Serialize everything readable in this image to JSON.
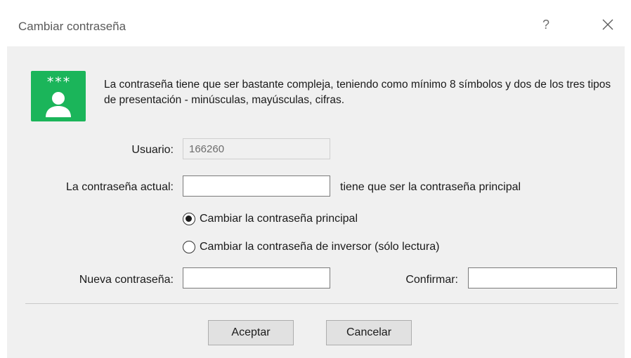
{
  "window": {
    "title": "Cambiar contraseña",
    "help_glyph": "?",
    "close_icon": "close-icon"
  },
  "info": {
    "icon": "user-password-icon",
    "icon_color": "#1bb55a",
    "icon_stars": "***",
    "text": "La contraseña tiene que ser bastante compleja, teniendo como mínimo 8 símbolos y dos de los tres tipos de presentación - minúsculas, mayúsculas, cifras."
  },
  "form": {
    "user_label": "Usuario:",
    "user_value": "166260",
    "current_password_label": "La contraseña actual:",
    "current_password_value": "",
    "current_password_hint": "tiene que ser la contraseña principal",
    "radio_main": {
      "label": "Cambiar la contraseña principal",
      "checked": true
    },
    "radio_investor": {
      "label": "Cambiar la contraseña de inversor (sólo lectura)",
      "checked": false
    },
    "new_password_label": "Nueva contraseña:",
    "new_password_value": "",
    "confirm_label": "Confirmar:",
    "confirm_value": ""
  },
  "buttons": {
    "ok": "Aceptar",
    "cancel": "Cancelar"
  }
}
